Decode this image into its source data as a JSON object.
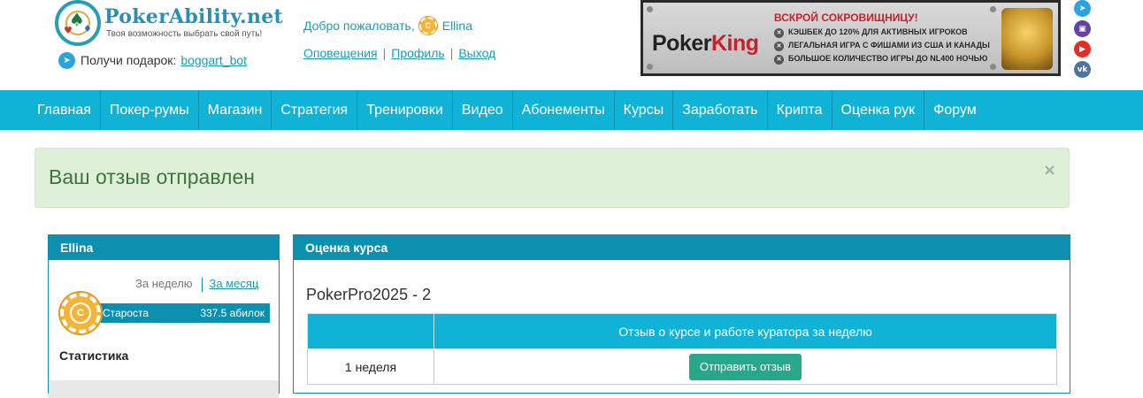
{
  "header": {
    "logo_name": "PokerAbility.net",
    "logo_tagline": "Твоя возможность выбрать свой путь!",
    "gift_text": "Получи подарок:",
    "gift_link": "boggart_bot",
    "welcome_text": "Добро пожаловать,",
    "username": "Ellina",
    "chip_letter": "C",
    "links": [
      "Оповещения",
      "Профиль",
      "Выход"
    ],
    "separator": "|"
  },
  "banner": {
    "brand_left": "Poker",
    "brand_right": "King",
    "title": "ВСКРОЙ СОКРОВИЩНИЦУ!",
    "lines": [
      "КЭШБЕК ДО 120% ДЛЯ АКТИВНЫХ ИГРОКОВ",
      "ЛЕГАЛЬНАЯ ИГРА С ФИШАМИ ИЗ США И КАНАДЫ",
      "БОЛЬШОЕ КОЛИЧЕСТВО ИГРЫ ДО NL400 НОЧЬЮ"
    ]
  },
  "social": [
    {
      "name": "telegram-icon",
      "color": "#2aa4dd",
      "glyph": "➤"
    },
    {
      "name": "twitch-icon",
      "color": "#6441a5",
      "glyph": "▣"
    },
    {
      "name": "youtube-icon",
      "color": "#e52d27",
      "glyph": "▶"
    },
    {
      "name": "vk-icon",
      "color": "#4c75a3",
      "glyph": "vk"
    }
  ],
  "nav": [
    "Главная",
    "Покер-румы",
    "Магазин",
    "Стратегия",
    "Тренировки",
    "Видео",
    "Абонементы",
    "Курсы",
    "Заработать",
    "Крипта",
    "Оценка рук",
    "Форум"
  ],
  "alert": {
    "message": "Ваш отзыв отправлен",
    "close": "×"
  },
  "left_panel": {
    "title": "Ellina",
    "period_week": "За неделю",
    "period_month": "За месяц",
    "chip_letter": "C",
    "rank_name": "Староста",
    "rank_points": "337.5 абилок",
    "stats_title": "Статистика"
  },
  "right_panel": {
    "title": "Оценка курса",
    "course_name": "PokerPro2025 - 2",
    "table": {
      "headers": [
        "",
        "Отзыв о курсе и работе куратора за неделю"
      ],
      "rows": [
        {
          "week": "1 неделя",
          "action": "Отправить отзыв"
        }
      ]
    }
  },
  "colors": {
    "nav_bg": "#10b2d6",
    "panel_head": "#0d8fb0",
    "link": "#1a9db2",
    "success_bg": "#dff0d8",
    "success_text": "#3c763d",
    "button": "#27a88a"
  }
}
